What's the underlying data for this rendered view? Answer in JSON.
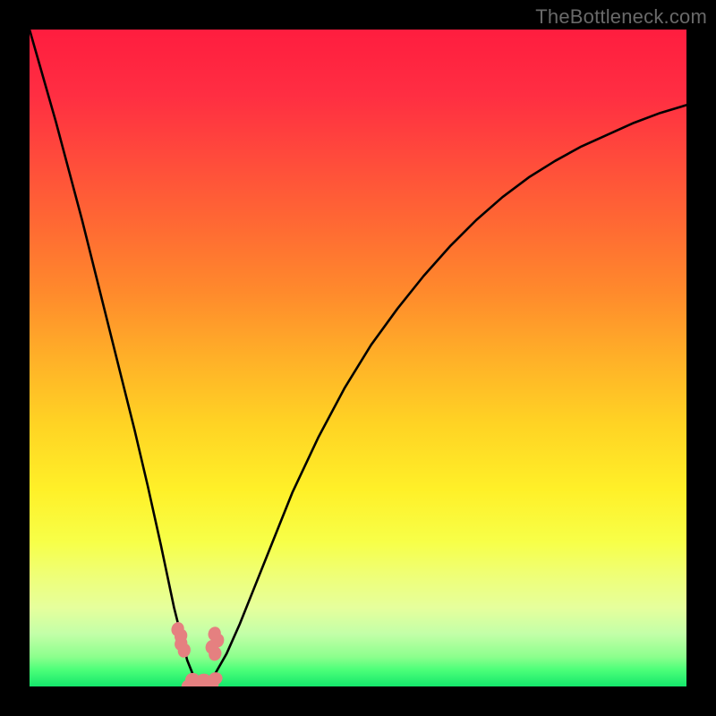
{
  "watermark": {
    "text": "TheBottleneck.com"
  },
  "chart_data": {
    "type": "line",
    "title": "",
    "xlabel": "",
    "ylabel": "",
    "xlim": [
      0,
      100
    ],
    "ylim": [
      0,
      100
    ],
    "series": [
      {
        "name": "bottleneck-curve",
        "x": [
          0,
          2,
          4,
          6,
          8,
          10,
          12,
          14,
          16,
          18,
          20,
          22,
          24,
          25,
          26,
          27,
          28,
          30,
          32,
          34,
          36,
          38,
          40,
          44,
          48,
          52,
          56,
          60,
          64,
          68,
          72,
          76,
          80,
          84,
          88,
          92,
          96,
          100
        ],
        "y": [
          100,
          93,
          86,
          78.5,
          71,
          63,
          55,
          47,
          39,
          30.5,
          21.5,
          12,
          4,
          1.5,
          0.5,
          0.5,
          1.5,
          5,
          9.5,
          14.5,
          19.5,
          24.5,
          29.5,
          38,
          45.5,
          52,
          57.5,
          62.5,
          67,
          71,
          74.5,
          77.5,
          80,
          82.2,
          84,
          85.8,
          87.3,
          88.5
        ]
      }
    ],
    "markers": [
      {
        "name": "left-marker-top",
        "x": 22.8,
        "y": 8.2
      },
      {
        "name": "left-marker-bottom",
        "x": 23.3,
        "y": 6.0
      },
      {
        "name": "right-marker-top",
        "x": 28.4,
        "y": 7.5
      },
      {
        "name": "right-marker-bottom",
        "x": 28.0,
        "y": 5.5
      },
      {
        "name": "bottom-marker-left",
        "x": 24.5,
        "y": 0.6
      },
      {
        "name": "bottom-marker-mid",
        "x": 26.2,
        "y": 0.5
      },
      {
        "name": "bottom-marker-right",
        "x": 28.0,
        "y": 0.7
      }
    ],
    "gradient_stops": [
      {
        "offset": 0.0,
        "color": "#ff1d3f"
      },
      {
        "offset": 0.1,
        "color": "#ff2e42"
      },
      {
        "offset": 0.2,
        "color": "#ff4c3b"
      },
      {
        "offset": 0.3,
        "color": "#ff6a33"
      },
      {
        "offset": 0.4,
        "color": "#ff8a2c"
      },
      {
        "offset": 0.5,
        "color": "#ffb028"
      },
      {
        "offset": 0.6,
        "color": "#ffd324"
      },
      {
        "offset": 0.7,
        "color": "#fff028"
      },
      {
        "offset": 0.78,
        "color": "#f7ff48"
      },
      {
        "offset": 0.83,
        "color": "#efff76"
      },
      {
        "offset": 0.88,
        "color": "#e6ff9c"
      },
      {
        "offset": 0.92,
        "color": "#c3ffa8"
      },
      {
        "offset": 0.955,
        "color": "#8cff8d"
      },
      {
        "offset": 0.975,
        "color": "#4bff79"
      },
      {
        "offset": 1.0,
        "color": "#14e66b"
      }
    ],
    "marker_color": "#e58080",
    "curve_color": "#000000"
  }
}
